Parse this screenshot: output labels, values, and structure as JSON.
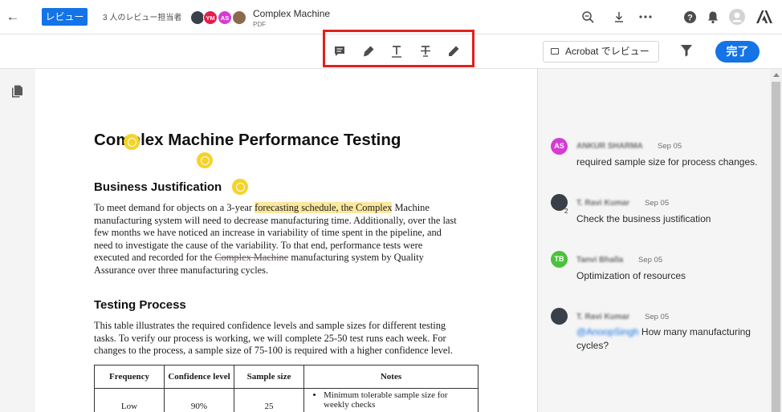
{
  "header": {
    "review_badge": "レビュー",
    "reviewers_label": "3 人のレビュー担当者",
    "avatars": [
      {
        "initials": "",
        "color": "#3a4048"
      },
      {
        "initials": "YM",
        "color": "#e21d4c"
      },
      {
        "initials": "AS",
        "color": "#d63bd6"
      },
      {
        "initials": "",
        "color": "#8a6a4a"
      }
    ],
    "doc_title": "Complex Machine",
    "doc_type": "PDF"
  },
  "toolbar": {
    "tools": [
      {
        "name": "add-comment-icon"
      },
      {
        "name": "highlight-icon"
      },
      {
        "name": "underline-text-icon"
      },
      {
        "name": "strikethrough-text-icon"
      },
      {
        "name": "draw-icon"
      }
    ],
    "acrobat_button": "Acrobat でレビュー",
    "done_button": "完了"
  },
  "document": {
    "title": "Complex Machine Performance Testing",
    "section1_heading": "Business Justification",
    "para1": {
      "line1_pre": "To meet demand for objects on a 3-year ",
      "line1_highlight": "forecasting schedule, the Complex",
      "line1_post": " Machine",
      "line2": "manufacturing system will need to decrease manufacturing time. Additionally, over the last",
      "line3": "few months we have noticed an increase in variability of time spent in the pipeline, and",
      "line4": "need to investigate the cause of the variability. To that end, performance tests were",
      "line5_pre": "executed and recorded for the ",
      "line5_strike": "Complex Machine",
      "line5_post": " manufacturing system by Quality",
      "line6": "Assurance over three manufacturing cycles."
    },
    "section2_heading": "Testing Process",
    "para2": {
      "line1": "This table illustrates the required confidence levels and sample sizes for different testing",
      "line2": "tasks. To verify our process is working, we will complete 25-50 test runs each week. For",
      "line3": "changes to the process, a sample size of 75-100 is required with a higher confidence level."
    },
    "table": {
      "headers": [
        "Frequency",
        "Confidence level",
        "Sample size",
        "Notes"
      ],
      "rows": [
        {
          "frequency": "Low",
          "confidence": "90%",
          "sample_size": "25",
          "note1": "Minimum tolerable sample size for weekly checks"
        }
      ]
    }
  },
  "comments": [
    {
      "initials": "AS",
      "color": "#d63bd6",
      "name": "ANKUR SHARMA",
      "date": "Sep 05",
      "text": "required sample size for process changes.",
      "mention": ""
    },
    {
      "initials": "",
      "color": "#3a4048",
      "badge": "2",
      "name": "T. Ravi Kumar",
      "date": "Sep 05",
      "text": "Check the business justification",
      "mention": ""
    },
    {
      "initials": "TB",
      "color": "#4bc23c",
      "name": "Tanvi Bhalla",
      "date": "Sep 05",
      "text": "Optimization of resources",
      "mention": ""
    },
    {
      "initials": "",
      "color": "#3a4048",
      "name": "T. Ravi Kumar",
      "date": "Sep 05",
      "mention": "@AnoopSingh",
      "text": " How many manufacturing cycles?"
    }
  ]
}
